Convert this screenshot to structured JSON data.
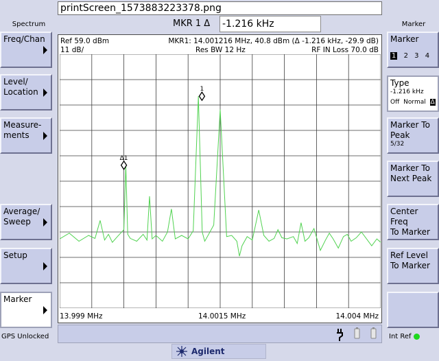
{
  "window": {
    "title": "printScreen_1573883223378.png"
  },
  "left_panel": {
    "title": "Spectrum",
    "keys": [
      {
        "label": "Freq/Chan"
      },
      {
        "label": "Level/\nLocation"
      },
      {
        "label": "Measure-\nments"
      },
      {
        "label": "Average/\nSweep"
      },
      {
        "label": "Setup"
      },
      {
        "label": "Marker",
        "active": true
      }
    ],
    "status": "GPS Unlocked"
  },
  "right_panel": {
    "title": "Marker",
    "marker": {
      "label": "Marker",
      "numbers": [
        "1",
        "2",
        "3",
        "4"
      ],
      "selected": "1"
    },
    "type": {
      "label": "Type",
      "value": "-1.216 kHz",
      "options": [
        "Off",
        "Normal",
        "Δ"
      ],
      "selected": "Δ"
    },
    "to_peak": {
      "label": "Marker To\nPeak",
      "sub": "5/32"
    },
    "next_peak": {
      "label": "Marker To\nNext Peak"
    },
    "center_freq": {
      "label": "Center Freq\nTo Marker"
    },
    "ref_level": {
      "label": "Ref Level\nTo Marker"
    },
    "int_ref": "Int Ref",
    "int_ref_color": "#1ed81e"
  },
  "marker_entry": {
    "label": "MKR 1 Δ",
    "value": "-1.216 kHz"
  },
  "display": {
    "ref_level": "Ref 59.0 dBm",
    "scale": "11 dB/",
    "marker_readout": "MKR1: 14.001216 MHz, 40.8 dBm (Δ -1.216 kHz, -29.9 dB)",
    "res_bw": "Res BW 12 Hz",
    "rf_in_loss": "RF IN Loss 70.0 dB",
    "freq_start": "13.999 MHz",
    "freq_center": "14.0015 MHz",
    "freq_stop": "14.004 MHz",
    "marker1_label": "1",
    "delta_marker_label": "Δ1",
    "trace_color": "#50d250"
  },
  "branding": {
    "name": "Agilent Technologies",
    "color": "#1e2a6e"
  },
  "chart_data": {
    "type": "line",
    "x_unit": "MHz",
    "y_unit": "dBm",
    "xlim": [
      13.999,
      14.004
    ],
    "ylim": [
      -51.0,
      59.0
    ],
    "grid": true,
    "series": [
      {
        "x": [
          13.999,
          13.99915,
          13.9993,
          13.99945,
          13.99955,
          13.99963,
          13.9997,
          13.99976,
          13.99982,
          13.9999,
          14.0,
          14.00003,
          14.00006,
          14.0001,
          14.0002,
          14.0003,
          14.00036,
          14.0004,
          14.00044,
          14.0005,
          14.0006,
          14.00068,
          14.00074,
          14.0008,
          14.0009,
          14.001,
          14.00108,
          14.00116,
          14.00122,
          14.00126,
          14.00132,
          14.0014,
          14.0015,
          14.0016,
          14.00168,
          14.00176,
          14.0018,
          14.00184,
          14.00192,
          14.002,
          14.0021,
          14.00218,
          14.00226,
          14.00234,
          14.0024,
          14.00246,
          14.00254,
          14.00264,
          14.0027,
          14.00276,
          14.00282,
          14.00288,
          14.00296,
          14.00306,
          14.00314,
          14.0032,
          14.00326,
          14.00334,
          14.00342,
          14.00348,
          14.00354,
          14.00362,
          14.0037,
          14.00378,
          14.00386,
          14.00394,
          14.004
        ],
        "y": [
          -21.0,
          -18.5,
          -22.0,
          -19.5,
          -20.8,
          -13.0,
          -21.5,
          -19.0,
          -22.5,
          -20.0,
          -17.0,
          11.0,
          -19.0,
          -20.8,
          -22.0,
          -19.0,
          -21.5,
          -2.5,
          -21.0,
          -19.5,
          -22.0,
          -18.0,
          -8.0,
          -21.0,
          -19.5,
          -21.0,
          -17.5,
          40.8,
          -18.0,
          -22.0,
          -19.0,
          -15.0,
          35.0,
          -20.0,
          -19.5,
          -22.0,
          -28.5,
          -24.0,
          -20.0,
          -21.5,
          -8.5,
          -19.5,
          -22.0,
          -20.8,
          -17.0,
          -20.5,
          -21.0,
          -20.0,
          -23.0,
          -14.0,
          -22.0,
          -20.5,
          -16.5,
          -26.0,
          -21.5,
          -18.5,
          -21.0,
          -25.0,
          -20.0,
          -19.0,
          -22.0,
          -20.5,
          -18.0,
          -21.0,
          -24.0,
          -21.0,
          -22.5
        ]
      }
    ],
    "markers": [
      {
        "label": "1",
        "x": 14.001216,
        "y": 40.8
      },
      {
        "label": "Δ1",
        "x": 14.0,
        "y": 10.9
      }
    ]
  }
}
